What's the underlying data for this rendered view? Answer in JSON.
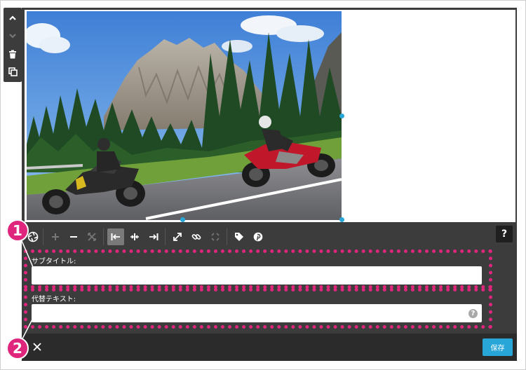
{
  "image": {
    "alt": "",
    "subject": "two motorcycles on a mountain road"
  },
  "side_toolbar": {
    "items": [
      {
        "name": "move-up",
        "icon": "chevron-up-icon"
      },
      {
        "name": "move-down",
        "icon": "chevron-down-icon"
      },
      {
        "name": "delete",
        "icon": "trash-icon"
      },
      {
        "name": "duplicate",
        "icon": "copy-icon"
      }
    ]
  },
  "toolbar": {
    "items": [
      {
        "icon": "aperture-icon",
        "enabled": true
      },
      {
        "icon": "plus-icon",
        "enabled": false
      },
      {
        "icon": "minus-icon",
        "enabled": true
      },
      {
        "icon": "fit-icon",
        "enabled": false
      },
      {
        "icon": "align-left-icon",
        "enabled": true,
        "active": true
      },
      {
        "icon": "align-center-icon",
        "enabled": true
      },
      {
        "icon": "align-right-icon",
        "enabled": true
      },
      {
        "icon": "expand-icon",
        "enabled": true
      },
      {
        "icon": "link-icon",
        "enabled": true
      },
      {
        "icon": "unlink-icon",
        "enabled": false
      },
      {
        "icon": "tag-icon",
        "enabled": true
      },
      {
        "icon": "pinterest-icon",
        "enabled": true
      }
    ],
    "help_label": "?"
  },
  "form": {
    "subtitle_label": "サブタイトル:",
    "subtitle_value": "",
    "alt_label": "代替テキスト:",
    "alt_value": "",
    "alt_help": "?"
  },
  "footer": {
    "save_label": "保存"
  },
  "annotations": {
    "badge1": "1",
    "badge2": "2",
    "color": "#e0257d"
  },
  "colors": {
    "panel": "#3c3c3c",
    "footer": "#2b2b2b",
    "accent": "#29a6d8",
    "highlight": "#e0257d"
  }
}
